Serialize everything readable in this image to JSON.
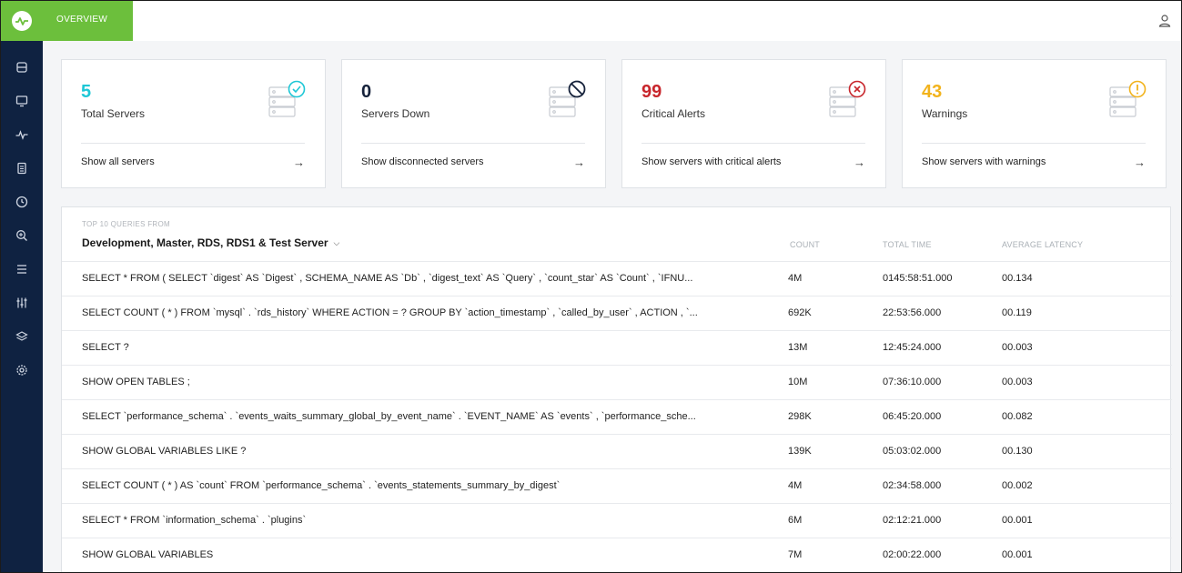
{
  "topbar": {
    "tab_label": "OVERVIEW",
    "user_icon": "user-icon"
  },
  "sidebar": {
    "logo_icon": "pulse-logo-icon",
    "items": [
      {
        "icon": "database-icon"
      },
      {
        "icon": "monitor-icon"
      },
      {
        "icon": "activity-icon"
      },
      {
        "icon": "document-icon"
      },
      {
        "icon": "clock-icon"
      },
      {
        "icon": "zoom-icon"
      },
      {
        "icon": "list-icon"
      },
      {
        "icon": "sliders-icon"
      },
      {
        "icon": "layers-icon"
      },
      {
        "icon": "settings-icon"
      }
    ]
  },
  "cards": [
    {
      "value": "5",
      "label": "Total Servers",
      "link": "Show all servers",
      "color": "#1ec7d6",
      "badge": "check-icon"
    },
    {
      "value": "0",
      "label": "Servers Down",
      "link": "Show disconnected servers",
      "color": "#15213a",
      "badge": "prohibited-icon"
    },
    {
      "value": "99",
      "label": "Critical Alerts",
      "link": "Show servers with critical alerts",
      "color": "#c8262c",
      "badge": "x-circle-icon"
    },
    {
      "value": "43",
      "label": "Warnings",
      "link": "Show servers with warnings",
      "color": "#f2b31c",
      "badge": "exclamation-icon"
    }
  ],
  "arrow": "→",
  "queries": {
    "subtitle": "TOP 10 QUERIES FROM",
    "source": "Development, Master, RDS, RDS1 & Test Server",
    "chevron": "⌵",
    "columns": {
      "count": "COUNT",
      "total_time": "TOTAL TIME",
      "avg_latency": "AVERAGE LATENCY"
    },
    "rows": [
      {
        "query": "SELECT * FROM ( SELECT `digest` AS `Digest` , SCHEMA_NAME AS `Db` , `digest_text` AS `Query` , `count_star` AS `Count` , `IFNU...",
        "count": "4M",
        "total_time": "0145:58:51.000",
        "latency": "00.134"
      },
      {
        "query": "SELECT COUNT ( * ) FROM `mysql` . `rds_history` WHERE ACTION = ? GROUP BY `action_timestamp` , `called_by_user` , ACTION , `...",
        "count": "692K",
        "total_time": "22:53:56.000",
        "latency": "00.119"
      },
      {
        "query": "SELECT ?",
        "count": "13M",
        "total_time": "12:45:24.000",
        "latency": "00.003"
      },
      {
        "query": "SHOW OPEN TABLES ;",
        "count": "10M",
        "total_time": "07:36:10.000",
        "latency": "00.003"
      },
      {
        "query": "SELECT `performance_schema` . `events_waits_summary_global_by_event_name` . `EVENT_NAME` AS `events` , `performance_sche...",
        "count": "298K",
        "total_time": "06:45:20.000",
        "latency": "00.082"
      },
      {
        "query": "SHOW GLOBAL VARIABLES LIKE ?",
        "count": "139K",
        "total_time": "05:03:02.000",
        "latency": "00.130"
      },
      {
        "query": "SELECT COUNT ( * ) AS `count` FROM `performance_schema` . `events_statements_summary_by_digest`",
        "count": "4M",
        "total_time": "02:34:58.000",
        "latency": "00.002"
      },
      {
        "query": "SELECT * FROM `information_schema` . `plugins`",
        "count": "6M",
        "total_time": "02:12:21.000",
        "latency": "00.001"
      },
      {
        "query": "SHOW GLOBAL VARIABLES",
        "count": "7M",
        "total_time": "02:00:22.000",
        "latency": "00.001"
      }
    ]
  }
}
